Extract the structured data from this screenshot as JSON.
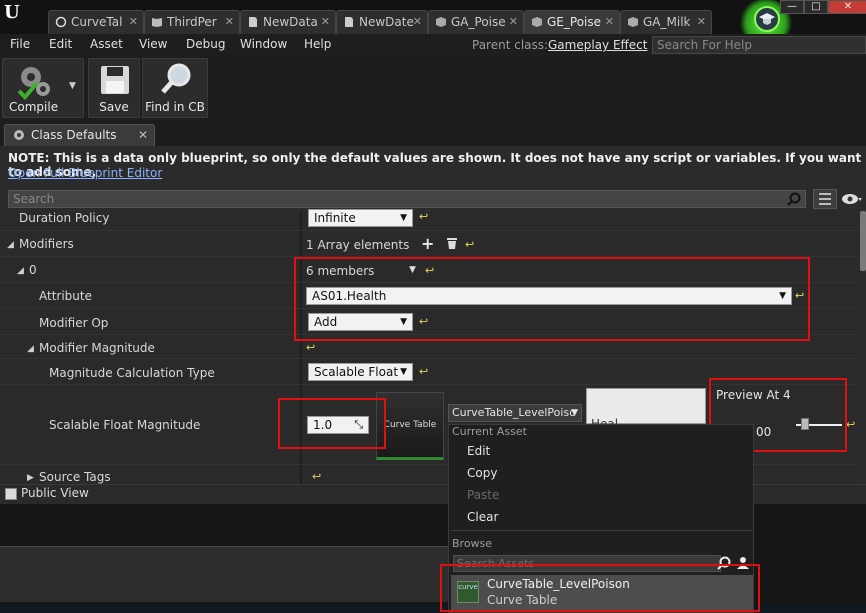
{
  "window": {
    "tabs": [
      {
        "label": "CurveTal",
        "icon": "circle-icon"
      },
      {
        "label": "ThirdPer",
        "icon": "book-icon"
      },
      {
        "label": "NewData",
        "icon": "document-icon"
      },
      {
        "label": "NewDate",
        "icon": "document-icon"
      },
      {
        "label": "GA_Poise",
        "icon": "blueprint-icon"
      },
      {
        "label": "GE_Poise",
        "icon": "blueprint-icon"
      },
      {
        "label": "GA_Milk",
        "icon": "blueprint-icon"
      }
    ],
    "active_tab_index": 5,
    "buttons": {
      "minimize": "—",
      "maximize": "□",
      "close": "✕"
    }
  },
  "menu": {
    "items": [
      "File",
      "Edit",
      "Asset",
      "View",
      "Debug",
      "Window",
      "Help"
    ],
    "parent_class_label": "Parent class:",
    "parent_class_value": "Gameplay Effect",
    "help_search_placeholder": "Search For Help"
  },
  "toolbar": {
    "compile_label": "Compile",
    "save_label": "Save",
    "find_label": "Find in CB"
  },
  "details": {
    "tab_label": "Class Defaults",
    "note": "NOTE: This is a data only blueprint, so only the default values are shown.  It does not have any script or variables.  If you want to add some,",
    "open_editor_link": "Open Full Blueprint Editor",
    "search_placeholder": "Search",
    "properties": {
      "duration_policy_label": "Duration Policy",
      "duration_policy_value": "Infinite",
      "modifiers_label": "Modifiers",
      "modifiers_value": "1 Array elements",
      "index_label": "0",
      "members_value": "6 members",
      "attribute_label": "Attribute",
      "attribute_value": "AS01.Health",
      "modifier_op_label": "Modifier Op",
      "modifier_op_value": "Add",
      "modifier_magnitude_label": "Modifier Magnitude",
      "calc_type_label": "Magnitude Calculation Type",
      "calc_type_value": "Scalable Float",
      "scalable_label": "Scalable Float Magnitude",
      "scalable_value": "1.0",
      "curve_thumb_label": "Curve Table",
      "curve_asset_value": "CurveTable_LevelPoiso",
      "white_btn_text": "Heal",
      "preview_label": "Preview At 4",
      "preview_value": "00",
      "source_tags_label": "Source Tags"
    },
    "public_view_label": "Public View"
  },
  "context_menu": {
    "current_asset_header": "Current Asset",
    "items": [
      "Edit",
      "Copy",
      "Paste",
      "Clear"
    ],
    "disabled_item": "Paste",
    "browse_header": "Browse",
    "search_placeholder": "Search Assets",
    "asset_icon_text": "curve",
    "asset_name": "CurveTable_LevelPoison",
    "asset_type": "Curve Table"
  },
  "colors": {
    "highlight_box": "#e01010",
    "link": "#8ab4ff",
    "reset_arrow": "#e6d25c"
  }
}
